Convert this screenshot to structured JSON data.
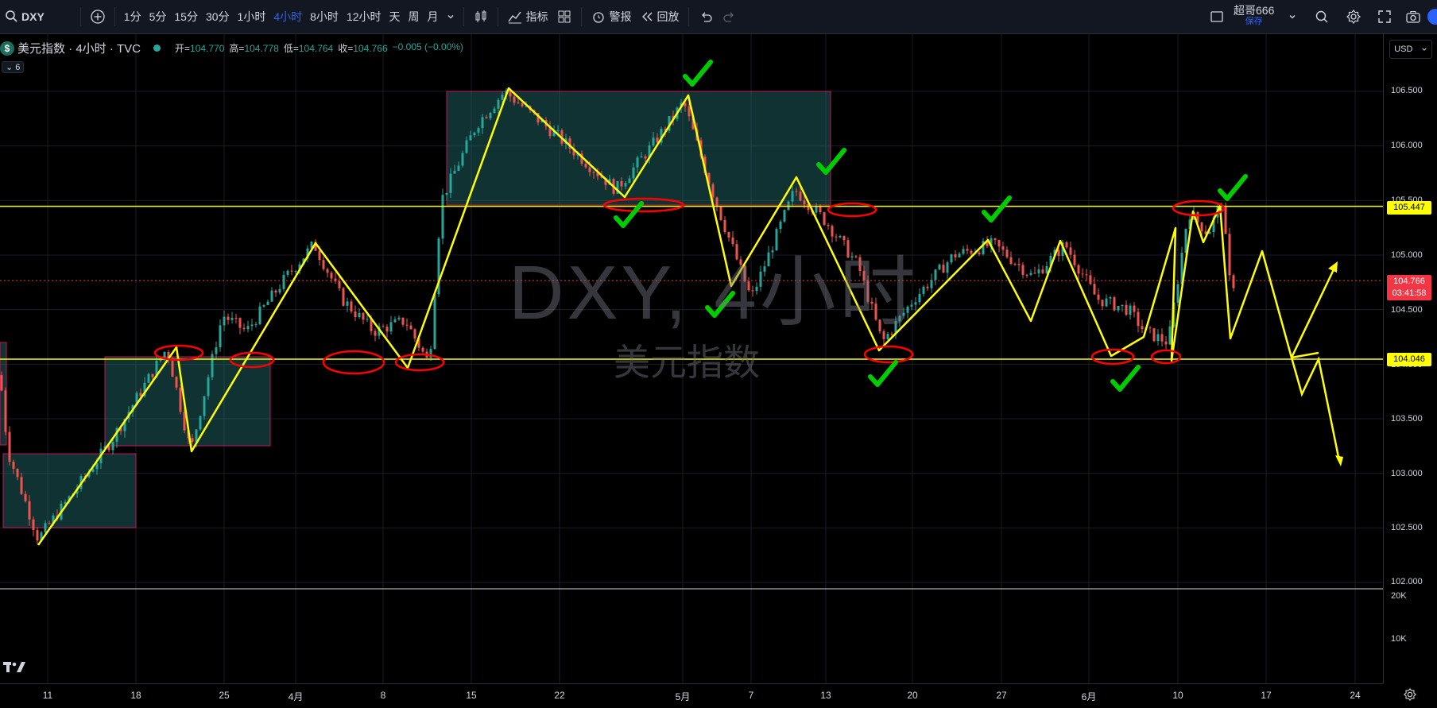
{
  "toolbar": {
    "symbol": "DXY",
    "intervals": [
      "1分",
      "5分",
      "15分",
      "30分",
      "1小时",
      "4小时",
      "8小时",
      "12小时",
      "天",
      "周",
      "月"
    ],
    "active_interval": "4小时",
    "indicators_label": "指标",
    "alert_label": "警报",
    "replay_label": "回放",
    "user_name": "超哥666",
    "save_label": "保存"
  },
  "legend": {
    "logo": "$",
    "title": "美元指数 · 4小时 · TVC",
    "open_k": "开=",
    "open_v": "104.770",
    "high_k": "高=",
    "high_v": "104.778",
    "low_k": "低=",
    "low_v": "104.764",
    "close_k": "收=",
    "close_v": "104.766",
    "change": "−0.005 (−0.00%)",
    "collapsed_count": "6"
  },
  "currency": "USD",
  "watermark": {
    "line1": "DXY, 4小时",
    "line2": "美元指数"
  },
  "price_scale": {
    "ticks": [
      "106.500",
      "106.000",
      "105.500",
      "105.000",
      "104.500",
      "104.000",
      "103.500",
      "103.000",
      "102.500",
      "102.000"
    ],
    "volume_ticks": [
      "20K",
      "10K"
    ]
  },
  "price_tags": {
    "resistance": "105.447",
    "last_price": "104.766",
    "countdown": "03:41:58",
    "support": "104.046"
  },
  "time_axis": [
    "11",
    "18",
    "25",
    "4月",
    "8",
    "15",
    "22",
    "5月",
    "7",
    "13",
    "20",
    "27",
    "6月",
    "10",
    "17",
    "24"
  ],
  "colors": {
    "up": "#26a69a",
    "down": "#ef5350",
    "hline": "#ffff00",
    "drawing": "#ffff00",
    "ellipse": "#ff0000",
    "check": "#00cc00",
    "last_price": "#f23645"
  }
}
